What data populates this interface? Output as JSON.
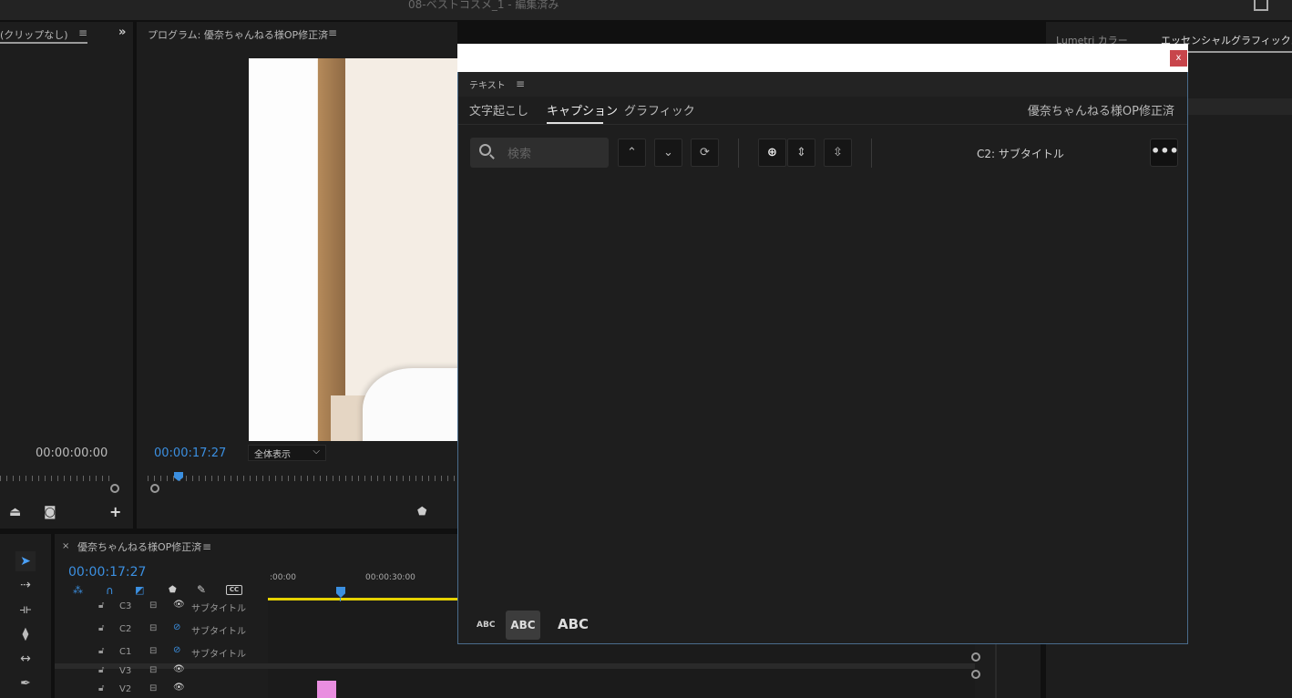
{
  "app": {
    "title": "08-ベストコスメ_1 - 編集済み"
  },
  "source_monitor": {
    "tab_label": "(クリップなし)",
    "timecode": "00:00:00:00"
  },
  "program_monitor": {
    "tab_label": "プログラム: 優奈ちゃんねる様OP修正済",
    "timecode": "00:00:17:27",
    "zoom": "全体表示"
  },
  "right_panel": {
    "tabs": [
      "Lumetri カラー",
      "エッセンシャルグラフィックス"
    ]
  },
  "text_dialog": {
    "close_label": "x",
    "panel_title": "テキスト",
    "tabs": [
      "文字起こし",
      "キャプション",
      "グラフィック"
    ],
    "active_tab": "キャプション",
    "sequence_name": "優奈ちゃんねる様OP修正済",
    "search_placeholder": "検索",
    "track_label": "C2: サブタイトル",
    "more_label": "•••",
    "size_buttons": [
      "ABC",
      "ABC",
      "ABC"
    ]
  },
  "timeline": {
    "close_label": "×",
    "sequence_name": "優奈ちゃんねる様OP修正済",
    "timecode": "00:00:17:27",
    "ruler_labels": [
      ":00:00",
      "00:00:30:00"
    ],
    "tracks": [
      {
        "name": "C3",
        "label": "サブタイトル"
      },
      {
        "name": "C2",
        "label": "サブタイトル"
      },
      {
        "name": "C1",
        "label": "サブタイトル"
      },
      {
        "name": "V3",
        "label": ""
      },
      {
        "name": "V2",
        "label": ""
      }
    ]
  },
  "colors": {
    "accent_blue": "#3b8fe0",
    "close_red": "#c8454b",
    "work_area_yellow": "#e6d200",
    "clip_pink": "#e98ee0"
  }
}
